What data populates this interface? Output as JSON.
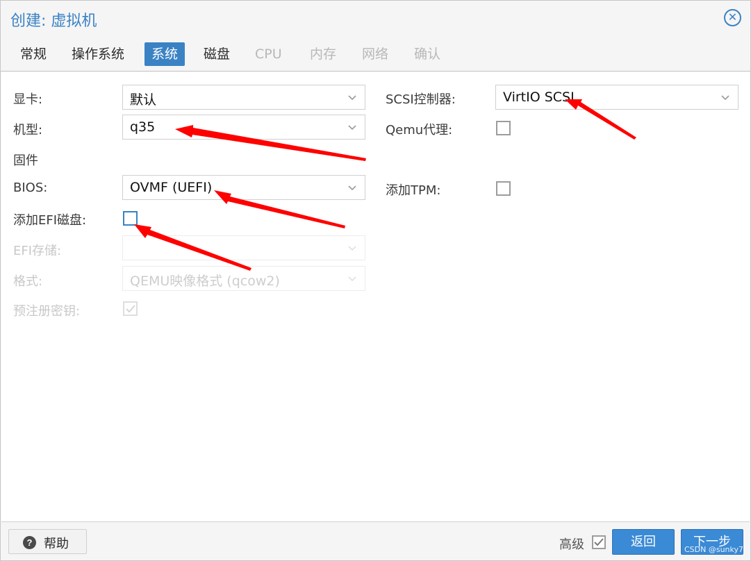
{
  "window": {
    "title": "创建: 虚拟机"
  },
  "tabs": [
    {
      "label": "常规",
      "state": "normal"
    },
    {
      "label": "操作系统",
      "state": "normal"
    },
    {
      "label": "系统",
      "state": "active"
    },
    {
      "label": "磁盘",
      "state": "normal"
    },
    {
      "label": "CPU",
      "state": "disabled"
    },
    {
      "label": "内存",
      "state": "disabled"
    },
    {
      "label": "网络",
      "state": "disabled"
    },
    {
      "label": "确认",
      "state": "disabled"
    }
  ],
  "form": {
    "graphics_card": {
      "label": "显卡:",
      "value": "默认"
    },
    "machine": {
      "label": "机型:",
      "value": "q35"
    },
    "firmware_heading": "固件",
    "bios": {
      "label": "BIOS:",
      "value": "OVMF (UEFI)"
    },
    "add_efi_disk": {
      "label": "添加EFI磁盘:",
      "checked": false
    },
    "efi_storage": {
      "label": "EFI存储:",
      "value": "",
      "disabled": true
    },
    "format": {
      "label": "格式:",
      "value": "QEMU映像格式 (qcow2)",
      "disabled": true
    },
    "pre_enrolled_keys": {
      "label": "预注册密钥:",
      "checked": true,
      "disabled": true
    },
    "scsi_controller": {
      "label": "SCSI控制器:",
      "value": "VirtIO SCSI"
    },
    "qemu_agent": {
      "label": "Qemu代理:",
      "checked": false
    },
    "add_tpm": {
      "label": "添加TPM:",
      "checked": false
    }
  },
  "footer": {
    "help_label": "帮助",
    "advanced_label": "高级",
    "advanced_checked": true,
    "back_label": "返回",
    "next_label": "下一步"
  },
  "watermark": "CSDN @sunky7",
  "colors": {
    "accent": "#3a82c4",
    "annotation_arrow": "#ff0000"
  },
  "icons": [
    "close-icon",
    "chevron-down-icon",
    "help-icon",
    "checkmark-icon"
  ]
}
